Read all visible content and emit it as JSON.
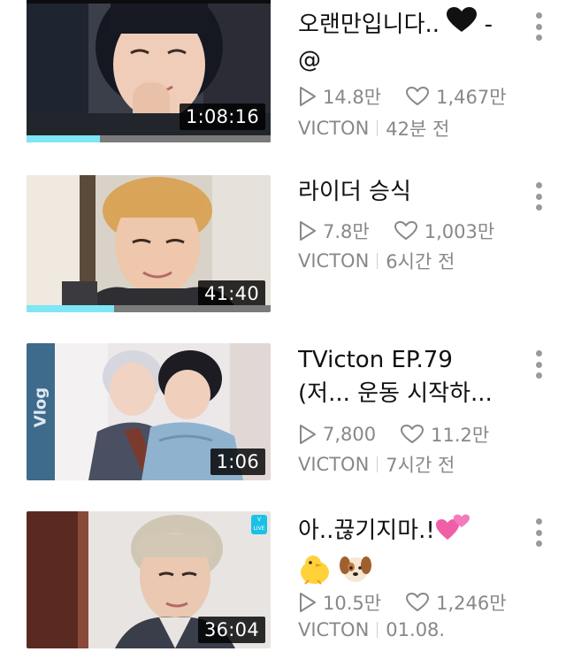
{
  "videos": [
    {
      "title_line1": "오랜만입니다.. ",
      "title_line1_tail": " -",
      "title_line2": "@",
      "views": "14.8만",
      "likes": "1,467만",
      "channel": "VICTON",
      "time": "42분 전",
      "duration": "1:08:16",
      "progress": 0.3
    },
    {
      "title_line1": "라이더 승식",
      "views": "7.8만",
      "likes": "1,003만",
      "channel": "VICTON",
      "time": "6시간 전",
      "duration": "41:40",
      "progress": 0.36
    },
    {
      "title_line1": "TVicton EP.79",
      "title_line2": "(저... 운동 시작하...",
      "views": "7,800",
      "likes": "11.2만",
      "channel": "VICTON",
      "time": "7시간 전",
      "duration": "1:06",
      "thumb_side_text": "Vlog"
    },
    {
      "title_line1": "아..끊기지마.!",
      "views": "10.5만",
      "likes": "1,246만",
      "channel": "VICTON",
      "time": "01.08.",
      "duration": "36:04",
      "thumb_badge": "V LIVE"
    }
  ],
  "icons": {
    "play": "play-outline-icon",
    "like": "heart-outline-icon",
    "more": "more-vertical-icon"
  },
  "colors": {
    "progress_fill": "#7fe6f5",
    "progress_track": "#7b7b7b",
    "meta_text": "#888888"
  }
}
